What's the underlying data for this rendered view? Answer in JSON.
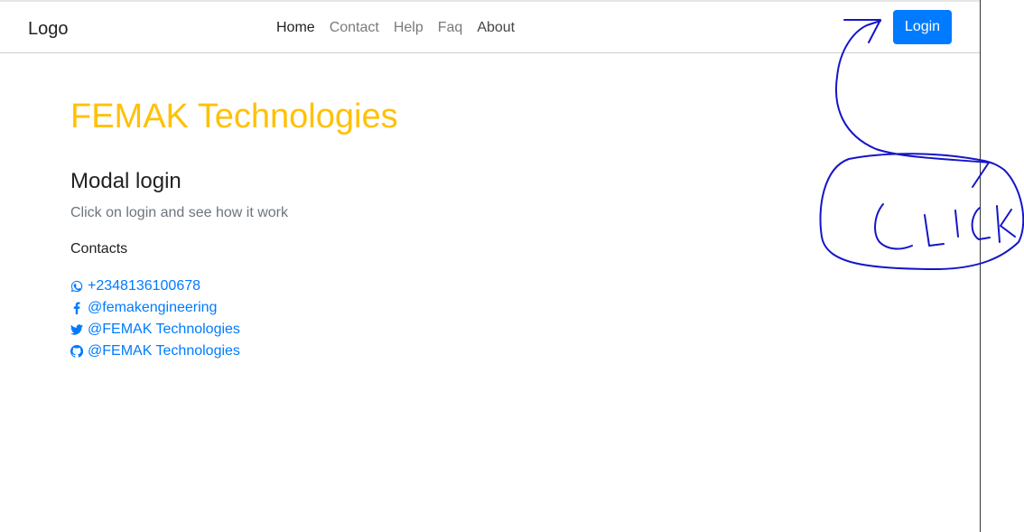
{
  "navbar": {
    "brand": "Logo",
    "links": [
      "Home",
      "Contact",
      "Help",
      "Faq",
      "About"
    ],
    "login_label": "Login"
  },
  "hero": {
    "title": "FEMAK Technologies"
  },
  "section": {
    "heading": "Modal login",
    "subtitle": "Click on login and see how it work",
    "contacts_label": "Contacts"
  },
  "contacts": [
    {
      "icon": "whatsapp-icon",
      "text": "+2348136100678"
    },
    {
      "icon": "facebook-icon",
      "text": "@femakengineering"
    },
    {
      "icon": "twitter-icon",
      "text": "@FEMAK Technologies"
    },
    {
      "icon": "github-icon",
      "text": "@FEMAK Technologies"
    }
  ],
  "annotation": {
    "text": "CLICK",
    "color": "#1515c8"
  },
  "colors": {
    "primary": "#007bff",
    "hero": "#ffc107"
  }
}
